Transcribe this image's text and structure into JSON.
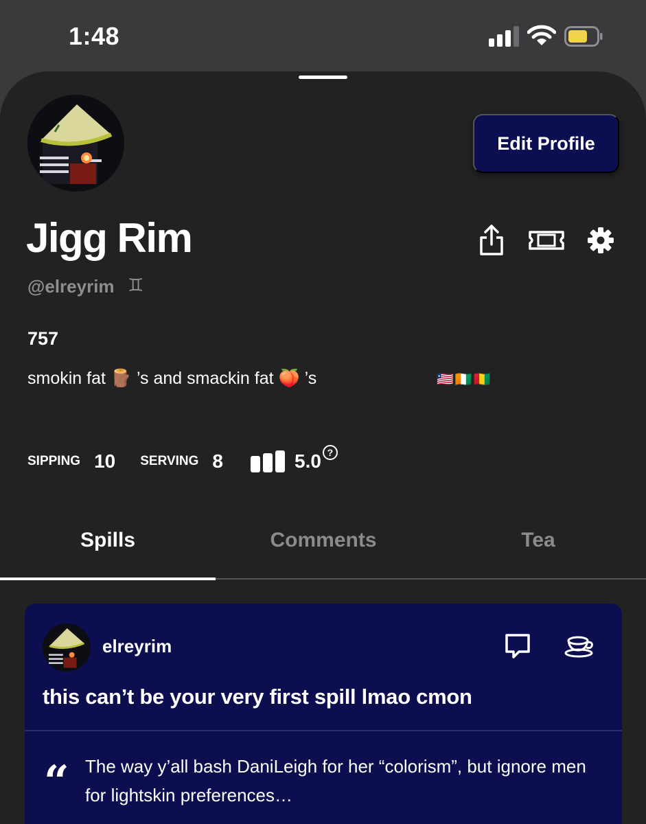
{
  "status_bar": {
    "time": "1:48"
  },
  "profile": {
    "edit_button": "Edit Profile",
    "display_name": "Jigg Rim",
    "handle": "@elreyrim",
    "zodiac_symbol": "♊",
    "area_code": "757",
    "bio": "smokin fat 🪵 ’s and smackin fat 🍑 ’s",
    "flags": "🇱🇷🇨🇮🇬🇳"
  },
  "stats": {
    "sipping_label": "SIPPING",
    "sipping_value": "10",
    "serving_label": "SERVING",
    "serving_value": "8",
    "rating_value": "5.0",
    "help_glyph": "?"
  },
  "tabs": [
    {
      "label": "Spills",
      "active": true
    },
    {
      "label": "Comments",
      "active": false
    },
    {
      "label": "Tea",
      "active": false
    }
  ],
  "spill_card": {
    "username": "elreyrim",
    "title": "this can’t be your very first spill lmao cmon",
    "quote_glyph": "“",
    "quote_text": "The way y’all bash DaniLeigh for her “colorism”, but ignore men for lightskin preferences…"
  },
  "icons": {
    "share": "share-icon",
    "ticket": "ticket-icon",
    "settings": "gear-icon",
    "comment": "comment-icon",
    "tea": "teacup-icon",
    "rating": "rating-bars-icon"
  },
  "colors": {
    "sheet_bg": "#222222",
    "accent_navy": "#0c0e52",
    "muted_text": "#8d8d92"
  }
}
